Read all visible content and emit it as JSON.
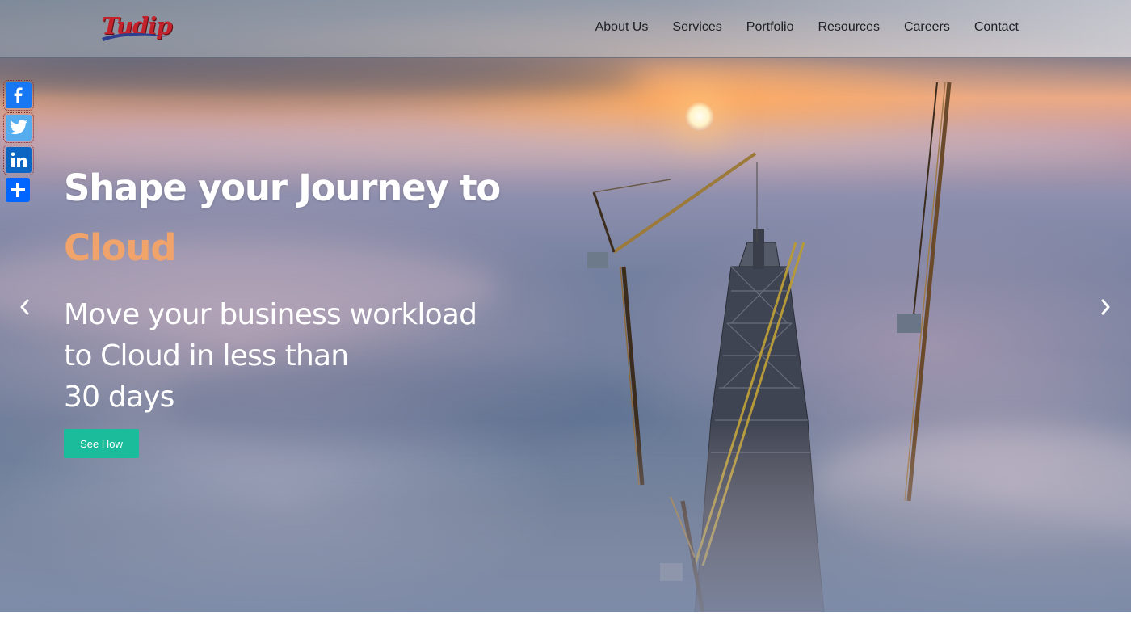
{
  "header": {
    "logo_text": "Tudip",
    "nav": [
      {
        "label": "About Us"
      },
      {
        "label": "Services"
      },
      {
        "label": "Portfolio"
      },
      {
        "label": "Resources"
      },
      {
        "label": "Careers"
      },
      {
        "label": "Contact"
      }
    ]
  },
  "social": {
    "items": [
      {
        "icon": "facebook-icon",
        "color": "#1877f2"
      },
      {
        "icon": "twitter-icon",
        "color": "#55acee"
      },
      {
        "icon": "linkedin-icon",
        "color": "#0a66c2"
      },
      {
        "icon": "share-plus-icon",
        "color": "#0166ff"
      }
    ]
  },
  "hero": {
    "headline": "Shape your Journey to",
    "headline_accent": "Cloud",
    "subhead_lines": [
      "Move your business workload",
      "to Cloud in less than",
      "30 days"
    ],
    "cta_label": "See How",
    "accent_color": "#f0a36a",
    "cta_color": "#1bbc9b"
  },
  "carousel": {
    "prev_icon": "chevron-left-icon",
    "next_icon": "chevron-right-icon"
  }
}
